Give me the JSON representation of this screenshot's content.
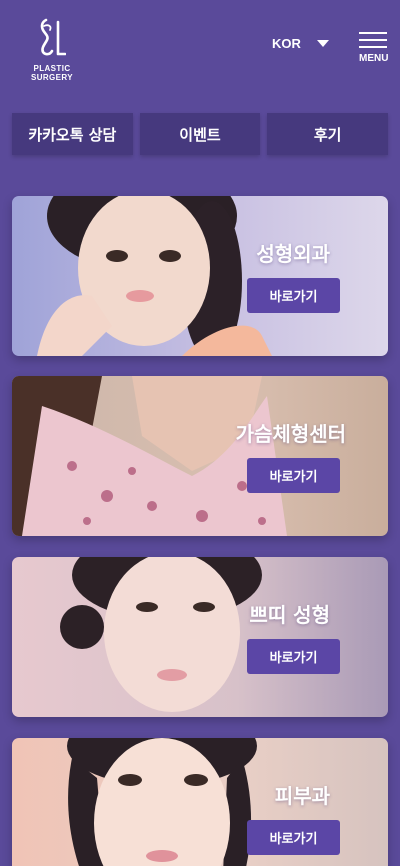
{
  "header": {
    "logo_text": "PLASTIC SURGERY",
    "language": "KOR",
    "menu_label": "MENU"
  },
  "tabs": [
    {
      "label": "카카오톡 상담"
    },
    {
      "label": "이벤트"
    },
    {
      "label": "후기"
    }
  ],
  "cards": [
    {
      "title": "성형외과",
      "button": "바로가기"
    },
    {
      "title": "가슴체형센터",
      "button": "바로가기"
    },
    {
      "title": "쁘띠 성형",
      "button": "바로가기"
    },
    {
      "title": "피부과",
      "button": "바로가기"
    }
  ],
  "colors": {
    "background": "#5a4a9a",
    "tab_bg": "#46397e",
    "button_bg": "#5b46a6"
  }
}
